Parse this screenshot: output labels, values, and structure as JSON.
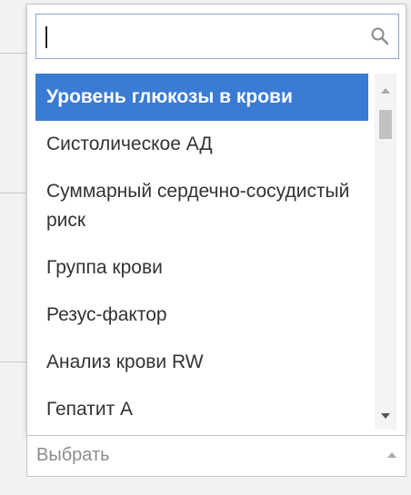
{
  "search": {
    "value": "",
    "placeholder": ""
  },
  "list": {
    "items": [
      {
        "label": "Уровень глюкозы в крови",
        "selected": true
      },
      {
        "label": "Систолическое АД",
        "selected": false
      },
      {
        "label": "Суммарный сердечно-сосудистый риск",
        "selected": false
      },
      {
        "label": "Группа крови",
        "selected": false
      },
      {
        "label": "Резус-фактор",
        "selected": false
      },
      {
        "label": "Анализ крови RW",
        "selected": false
      },
      {
        "label": "Гепатит А",
        "selected": false
      }
    ],
    "scroll_position_fraction": 0.0
  },
  "select": {
    "label": "Выбрать"
  },
  "colors": {
    "selected_background": "#3a7bd5",
    "selected_text": "#ffffff",
    "item_text": "#333333",
    "placeholder_text": "#8c8c8c",
    "search_border": "#8aa8d0"
  },
  "icons": {
    "search": "search-icon",
    "scroll_up": "triangle-up-icon",
    "scroll_down": "triangle-down-icon",
    "select_arrow": "triangle-up-icon"
  }
}
